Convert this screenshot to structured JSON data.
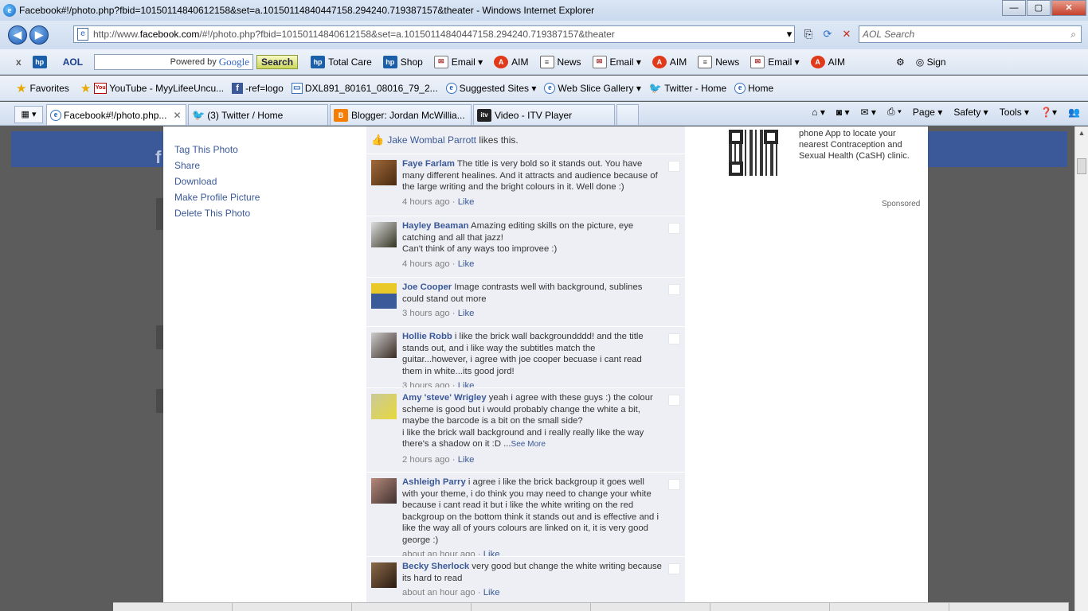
{
  "window": {
    "title": "Facebook#!/photo.php?fbid=10150114840612158&set=a.10150114840447158.294240.719387157&theater - Windows Internet Explorer",
    "minimize": "—",
    "restore": "▢",
    "close": "✕"
  },
  "address": {
    "url_prefix": "http://www.",
    "url_domain": "facebook.com",
    "url_rest": "/#!/photo.php?fbid=10150114840612158&set=a.10150114840447158.294240.719387157&theater",
    "search_placeholder": "AOL Search"
  },
  "toolbar": {
    "close": "x",
    "aol_label": "AOL",
    "powered_by": "Powered by",
    "google": "Google",
    "search_button": "Search",
    "items": [
      {
        "icon": "hp-icon",
        "label": "Total Care"
      },
      {
        "icon": "hp-icon",
        "label": "Shop"
      },
      {
        "icon": "email-icon",
        "label": "Email"
      },
      {
        "icon": "aim-icon",
        "label": "AIM"
      },
      {
        "icon": "news-icon",
        "label": "News"
      },
      {
        "icon": "email-icon",
        "label": "Email"
      },
      {
        "icon": "aim-icon",
        "label": "AIM"
      },
      {
        "icon": "news-icon",
        "label": "News"
      },
      {
        "icon": "email-icon",
        "label": "Email"
      },
      {
        "icon": "aim-icon",
        "label": "AIM"
      }
    ],
    "sign": "Sign"
  },
  "favorites": {
    "label": "Favorites",
    "links": [
      {
        "icon": "youtube-icon",
        "label": "YouTube - MyyLifeeUncu..."
      },
      {
        "icon": "facebook-icon",
        "label": "-ref=logo"
      },
      {
        "icon": "image-icon",
        "label": "DXL891_80161_08016_79_2..."
      },
      {
        "icon": "ie-icon",
        "label": "Suggested Sites ▾"
      },
      {
        "icon": "ie-icon",
        "label": "Web Slice Gallery ▾"
      },
      {
        "icon": "twitter-icon",
        "label": "Twitter - Home"
      },
      {
        "icon": "ie-icon",
        "label": "Home"
      }
    ]
  },
  "tabs": [
    {
      "label": "Facebook#!/photo.php...",
      "active": true
    },
    {
      "label": "(3) Twitter / Home",
      "active": false
    },
    {
      "label": "Blogger: Jordan McWillia...",
      "active": false
    },
    {
      "label": "Video - ITV Player",
      "active": false
    }
  ],
  "commandbar": {
    "page": "Page ▾",
    "safety": "Safety ▾",
    "tools": "Tools ▾"
  },
  "photo_actions": [
    "Tag This Photo",
    "Share",
    "Download",
    "Make Profile Picture",
    "Delete This Photo"
  ],
  "likes": {
    "name": "Jake Wombal Parrott",
    "text": "likes this."
  },
  "comments": [
    {
      "name": "Faye Farlam",
      "text": "The title is very bold so it stands out. You have many different healines. And it attracts and audience because of the large writing and the bright colours in it. Well done :)",
      "time": "4 hours ago",
      "like": "Like"
    },
    {
      "name": "Hayley Beaman",
      "text": "Amazing editing skills on the picture, eye catching and all that jazz!\nCan't think of any ways too improvee :)",
      "time": "4 hours ago",
      "like": "Like"
    },
    {
      "name": "Joe Cooper",
      "text": "Image contrasts well with background, sublines could stand out more",
      "time": "3 hours ago",
      "like": "Like"
    },
    {
      "name": "Hollie Robb",
      "text": "i like the brick wall backgroundddd! and the title stands out, and i like way the subtitles match the guitar...however, i agree with joe cooper becuase i cant read them in white...its good jord!",
      "time": "3 hours ago",
      "like": "Like"
    },
    {
      "name": "Amy 'steve' Wrigley",
      "text": "yeah i agree with these guys :) the colour scheme is good but i would probably change the white a bit, maybe the barcode is a bit on the small side?\ni like the brick wall background and i really really like the way there's a shadow on it :D ...",
      "see_more": "See More",
      "time": "2 hours ago",
      "like": "Like"
    },
    {
      "name": "Ashleigh Parry",
      "text": "i agree i like the brick backgroup it goes well with your theme, i do think you may need to change your white because i cant read it but i like the white writing on the red backgroup on the bottom think it stands out and is effective and i like the way all of yours colours are linked on it, it is very good george :)",
      "time": "about an hour ago",
      "like": "Like"
    },
    {
      "name": "Becky Sherlock",
      "text": "very good but change the white writing because its hard to read",
      "time": "about an hour ago",
      "like": "Like"
    }
  ],
  "ad": {
    "text": "phone App to locate your nearest Contraception and Sexual Health (CaSH) clinic.",
    "sponsored": "Sponsored"
  }
}
